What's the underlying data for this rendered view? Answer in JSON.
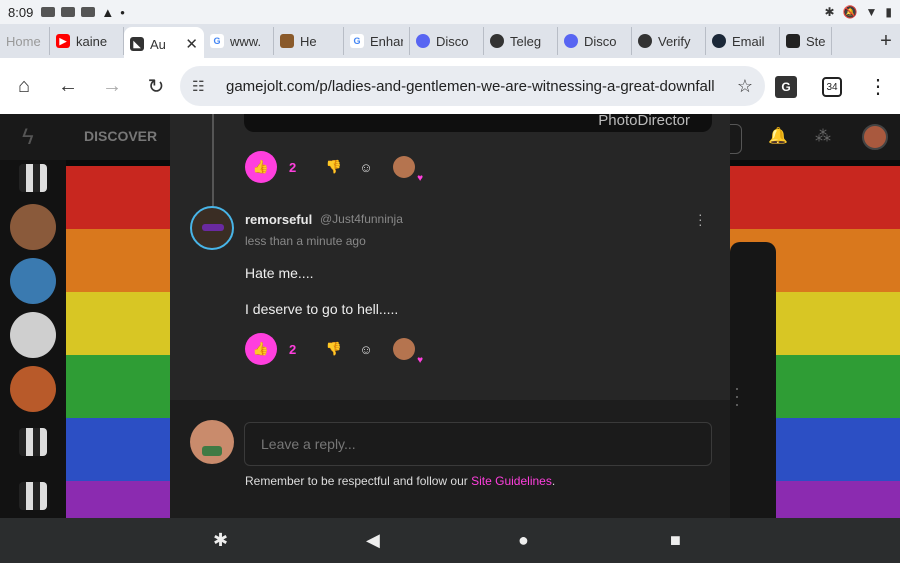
{
  "status": {
    "time": "8:09"
  },
  "tabs": [
    {
      "label": "Home",
      "active": false,
      "color": "#9aa0a6"
    },
    {
      "label": "kaine",
      "active": false,
      "color": "#ff0000"
    },
    {
      "label": "Au",
      "active": true,
      "color": "#333333"
    },
    {
      "label": "www.",
      "active": false,
      "color": "#4285f4"
    },
    {
      "label": "He",
      "active": false,
      "color": "#8a5a2b"
    },
    {
      "label": "Enhar",
      "active": false,
      "color": "#4285f4"
    },
    {
      "label": "Disco",
      "active": false,
      "color": "#5865f2"
    },
    {
      "label": "Teleg",
      "active": false,
      "color": "#333333"
    },
    {
      "label": "Disco",
      "active": false,
      "color": "#5865f2"
    },
    {
      "label": "Verify",
      "active": false,
      "color": "#333333"
    },
    {
      "label": "Email",
      "active": false,
      "color": "#1b2838"
    },
    {
      "label": "Ste",
      "active": false,
      "color": "#222222"
    }
  ],
  "address_bar": {
    "url": "gamejolt.com/p/ladies-and-gentlemen-we-are-witnessing-a-great-downfall",
    "tab_count": "34"
  },
  "site": {
    "nav_discover": "DISCOVER",
    "accent": "#ff3fde"
  },
  "image_watermark": "PhotoDirector",
  "top_actions": {
    "like_count": "2"
  },
  "comment": {
    "username": "remorseful",
    "handle": "@Just4funninja",
    "time_ago": "less than a minute ago",
    "lines": [
      "Hate me....",
      "I deserve to go to hell....."
    ],
    "like_count": "2"
  },
  "reply": {
    "placeholder": "Leave a reply...",
    "guidelines_prefix": "Remember to be respectful and follow our ",
    "guidelines_link": "Site Guidelines",
    "guidelines_suffix": "."
  },
  "rainbow_colors": [
    "#c8271f",
    "#d9781d",
    "#d8c624",
    "#2f9d35",
    "#2c4fc4",
    "#8b2bb0"
  ]
}
